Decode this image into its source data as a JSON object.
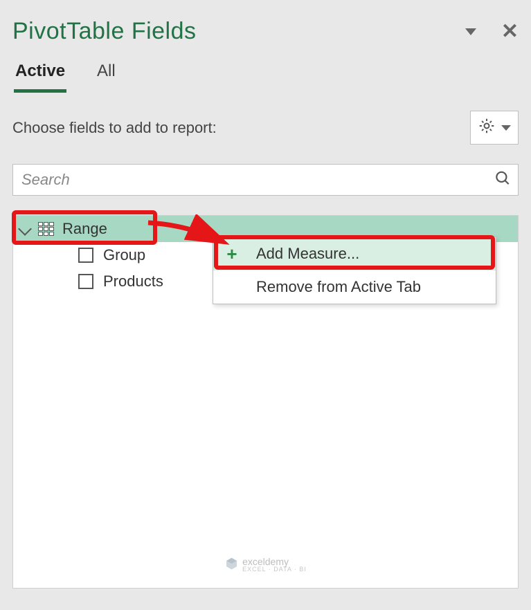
{
  "header": {
    "title": "PivotTable Fields"
  },
  "tabs": {
    "active": "Active",
    "all": "All"
  },
  "instruction": "Choose fields to add to report:",
  "search": {
    "placeholder": "Search"
  },
  "fields": {
    "table_name": "Range",
    "children": [
      {
        "label": "Group"
      },
      {
        "label": "Products"
      }
    ]
  },
  "context_menu": {
    "add_measure": "Add Measure...",
    "remove_tab": "Remove from Active Tab"
  },
  "watermark": {
    "name": "exceldemy",
    "tagline": "EXCEL · DATA · BI"
  }
}
